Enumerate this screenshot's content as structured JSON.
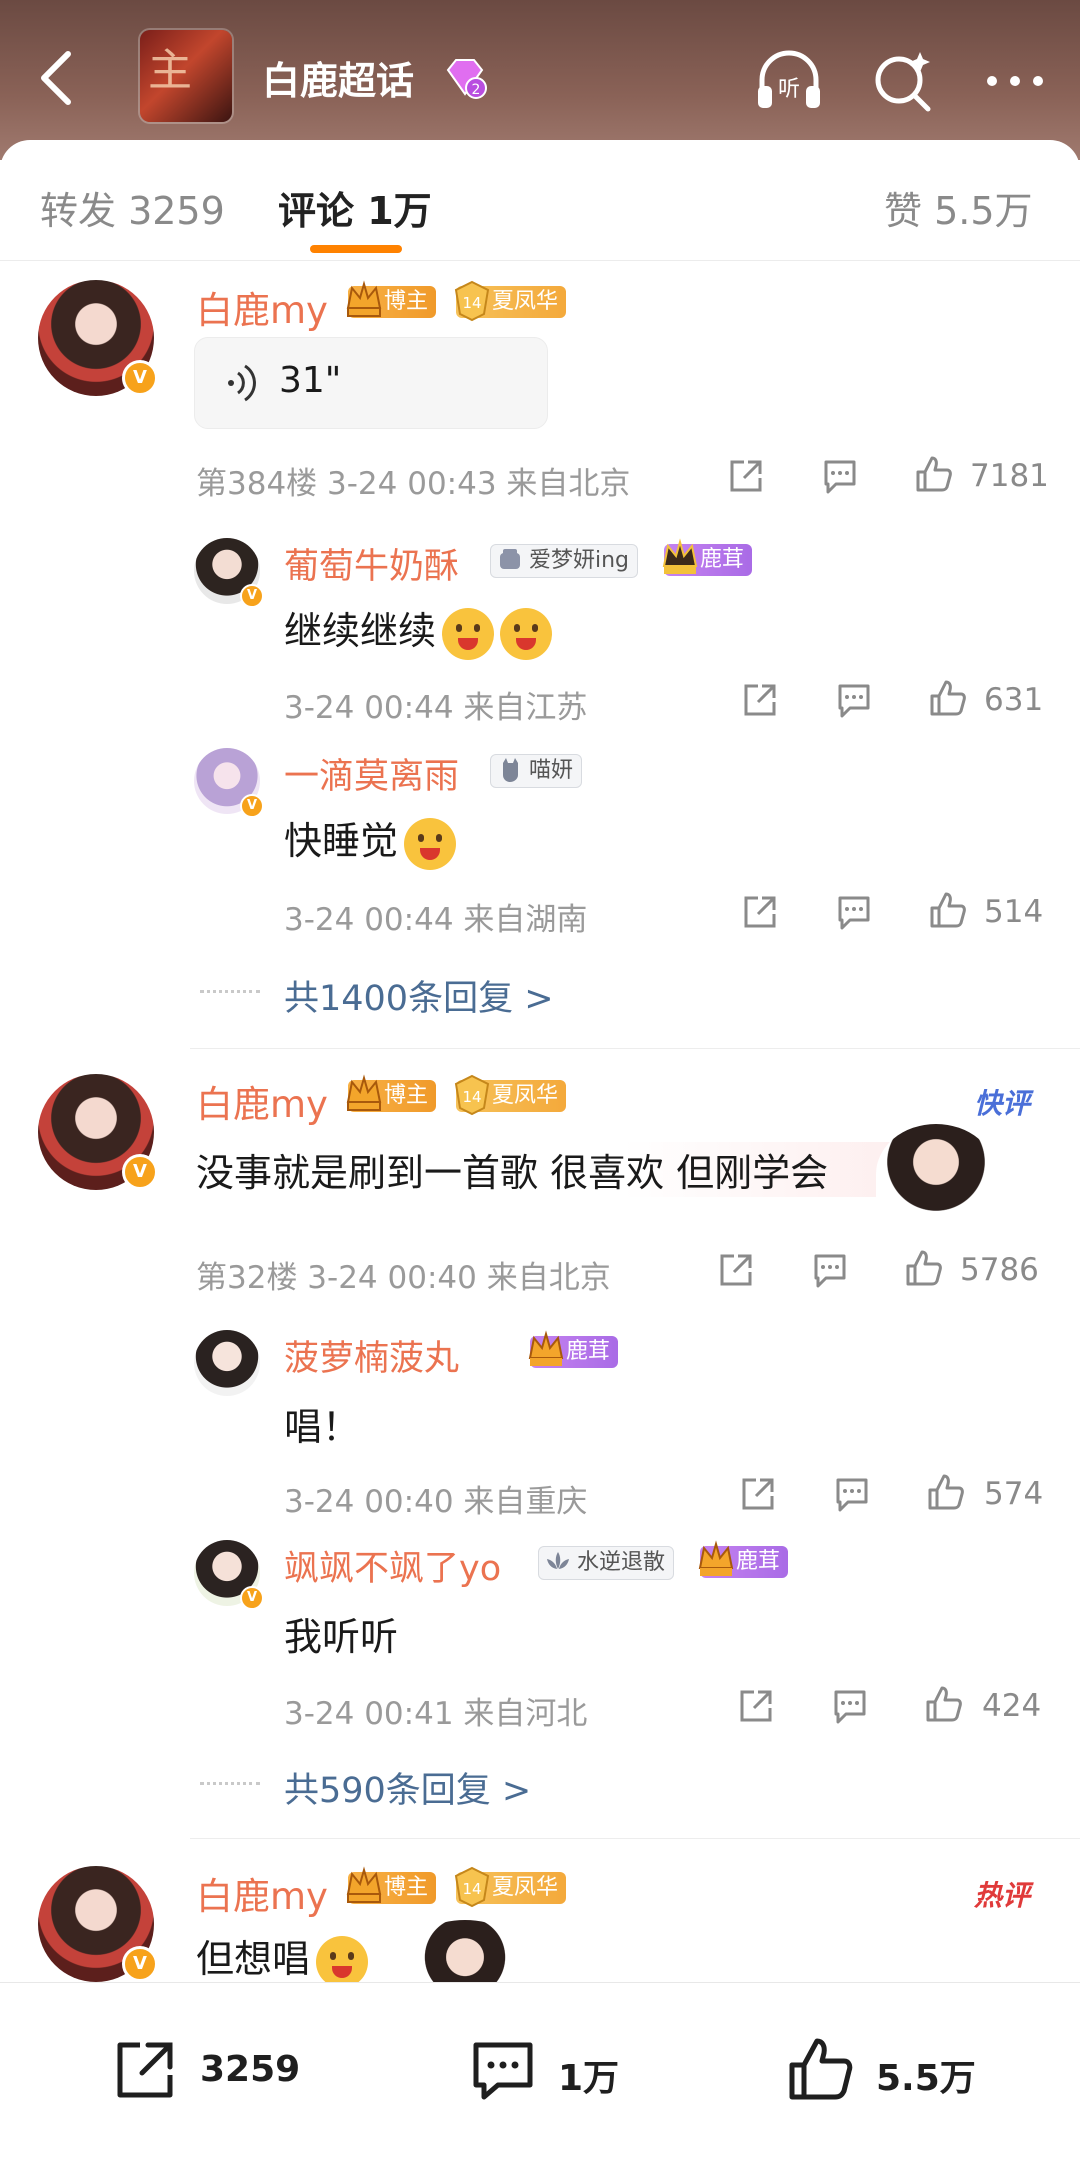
{
  "header": {
    "title": "白鹿超话",
    "logo_text": "主",
    "level_badge": "2",
    "icons": [
      "back-icon",
      "listen-icon",
      "search-icon",
      "more-icon"
    ]
  },
  "tabs": [
    {
      "label": "转发 3259",
      "active": false
    },
    {
      "label": "评论 1万",
      "active": true
    },
    {
      "label": "赞 5.5万",
      "active": false
    }
  ],
  "comments": [
    {
      "user": "白鹿my",
      "badges": {
        "role": "博主",
        "level": "14",
        "group": "夏凤华"
      },
      "voice_length": "31\"",
      "meta": "第384楼 3-24 00:43 来自北京",
      "likes": "7181",
      "replies": [
        {
          "user": "葡萄牛奶酥",
          "fan_badge": "爱梦妍ing",
          "group": "鹿茸",
          "text": "继续继续",
          "meta": "3-24 00:44 来自江苏",
          "likes": "631"
        },
        {
          "user": "一滴莫离雨",
          "fan_badge": "喵妍",
          "text": "快睡觉",
          "meta": "3-24 00:44 来自湖南",
          "likes": "514"
        }
      ],
      "more_replies": "共1400条回复 >"
    },
    {
      "user": "白鹿my",
      "badges": {
        "role": "博主",
        "level": "14",
        "group": "夏凤华"
      },
      "tag": "快评",
      "text": "没事就是刷到一首歌 很喜欢 但刚学会",
      "meta": "第32楼 3-24 00:40 来自北京",
      "likes": "5786",
      "replies": [
        {
          "user": "菠萝楠菠丸",
          "group": "鹿茸",
          "text": "唱！",
          "meta": "3-24 00:40 来自重庆",
          "likes": "574"
        },
        {
          "user": "飒飒不飒了yo",
          "fan_badge": "水逆退散",
          "group": "鹿茸",
          "text": "我听听",
          "meta": "3-24 00:41 来自河北",
          "likes": "424"
        }
      ],
      "more_replies": "共590条回复 >"
    },
    {
      "user": "白鹿my",
      "badges": {
        "role": "博主",
        "level": "14",
        "group": "夏凤华"
      },
      "tag": "热评",
      "text": "但想唱"
    }
  ],
  "bottom_bar": {
    "repost": "3259",
    "comment": "1万",
    "like": "5.5万"
  },
  "colors": {
    "name": "#eb7350",
    "link": "#4a6c93",
    "accent": "#ff8200",
    "header_bg": "#8a6257"
  }
}
